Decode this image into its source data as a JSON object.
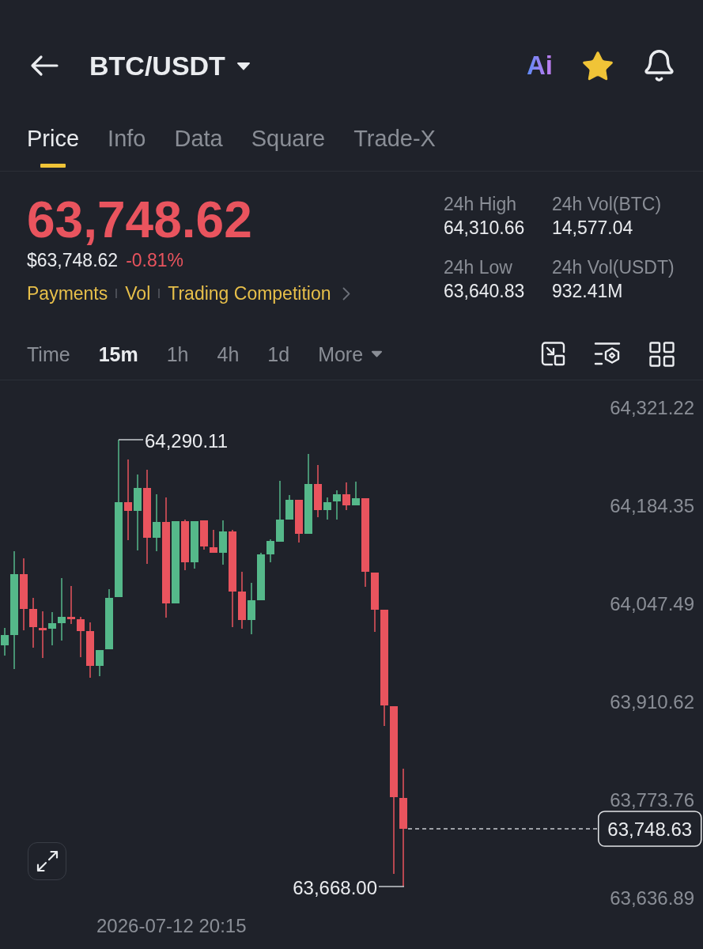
{
  "header": {
    "pair": "BTC/USDT",
    "ai_label": "Ai",
    "favorite": true
  },
  "tabs": [
    {
      "label": "Price",
      "selected": true
    },
    {
      "label": "Info",
      "selected": false
    },
    {
      "label": "Data",
      "selected": false
    },
    {
      "label": "Square",
      "selected": false
    },
    {
      "label": "Trade-X",
      "selected": false
    }
  ],
  "ticker": {
    "last_price": "63,748.62",
    "falling": true,
    "fiat_price": "$63,748.62",
    "change": "-0.81%"
  },
  "tags": [
    "Payments",
    "Vol",
    "Trading Competition"
  ],
  "stats": [
    {
      "label": "24h High",
      "value": "64,310.66"
    },
    {
      "label": "24h Vol(BTC)",
      "value": "14,577.04"
    },
    {
      "label": "24h Low",
      "value": "63,640.83"
    },
    {
      "label": "24h Vol(USDT)",
      "value": "932.41M"
    }
  ],
  "intervals": [
    {
      "label": "Time",
      "selected": false,
      "kind": "option"
    },
    {
      "label": "15m",
      "selected": true,
      "kind": "option"
    },
    {
      "label": "1h",
      "selected": false,
      "kind": "option"
    },
    {
      "label": "4h",
      "selected": false,
      "kind": "option"
    },
    {
      "label": "1d",
      "selected": false,
      "kind": "option"
    },
    {
      "label": "More",
      "selected": false,
      "kind": "dropdown"
    }
  ],
  "chart": {
    "y_axis_labels": [
      "64,321.22",
      "64,184.35",
      "64,047.49",
      "63,910.62",
      "63,773.76",
      "63,636.89"
    ],
    "high_marker": "64,290.11",
    "low_marker": "63,668.00",
    "current_price": "63,748.63",
    "time_label": "2026-07-12 20:15"
  }
}
